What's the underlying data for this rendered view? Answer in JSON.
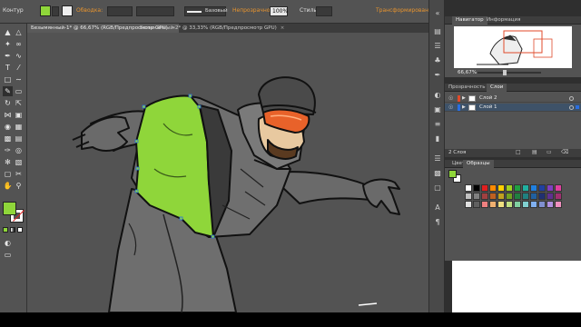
{
  "control_bar": {
    "object_label": "Контур",
    "stroke_label": "Обводка:",
    "stroke_profile": "Базовый",
    "opacity_label": "Непрозрачность:",
    "opacity_value": "100%",
    "styles_label": "Стиль:",
    "transform_label": "Трансформирование",
    "fill_color": "#8fd63a",
    "stroke_color": "#e8e8e8"
  },
  "tabs": [
    {
      "label": "Безымянный-1* @ 66,67% (RGB/Предпросмотр GPU)",
      "active": true
    },
    {
      "label": "Безымянный-2* @ 33,33% (RGB/Предпросмотр GPU)",
      "active": false
    }
  ],
  "tabs_close": "×",
  "navigator": {
    "tabs": [
      "Навигатор",
      "Информация"
    ],
    "zoom": "66,67%"
  },
  "layers_panel": {
    "tabs": [
      "Прозрачность",
      "Слои"
    ],
    "layers": [
      {
        "name": "Слой 2",
        "color": "#e04a2a",
        "selected": false
      },
      {
        "name": "Слой 1",
        "color": "#2a6ee0",
        "selected": true
      }
    ],
    "footer": "2 Слоя"
  },
  "color_panel": {
    "tabs": [
      "Цвет",
      "Образцы"
    ],
    "fill_color": "#8fd63a"
  },
  "toolbar": {
    "fill_color": "#8fd63a",
    "stroke_color": "#ffffff"
  },
  "colors": {
    "accent_green": "#8fd63a",
    "goggle_orange": "#e8622a"
  }
}
